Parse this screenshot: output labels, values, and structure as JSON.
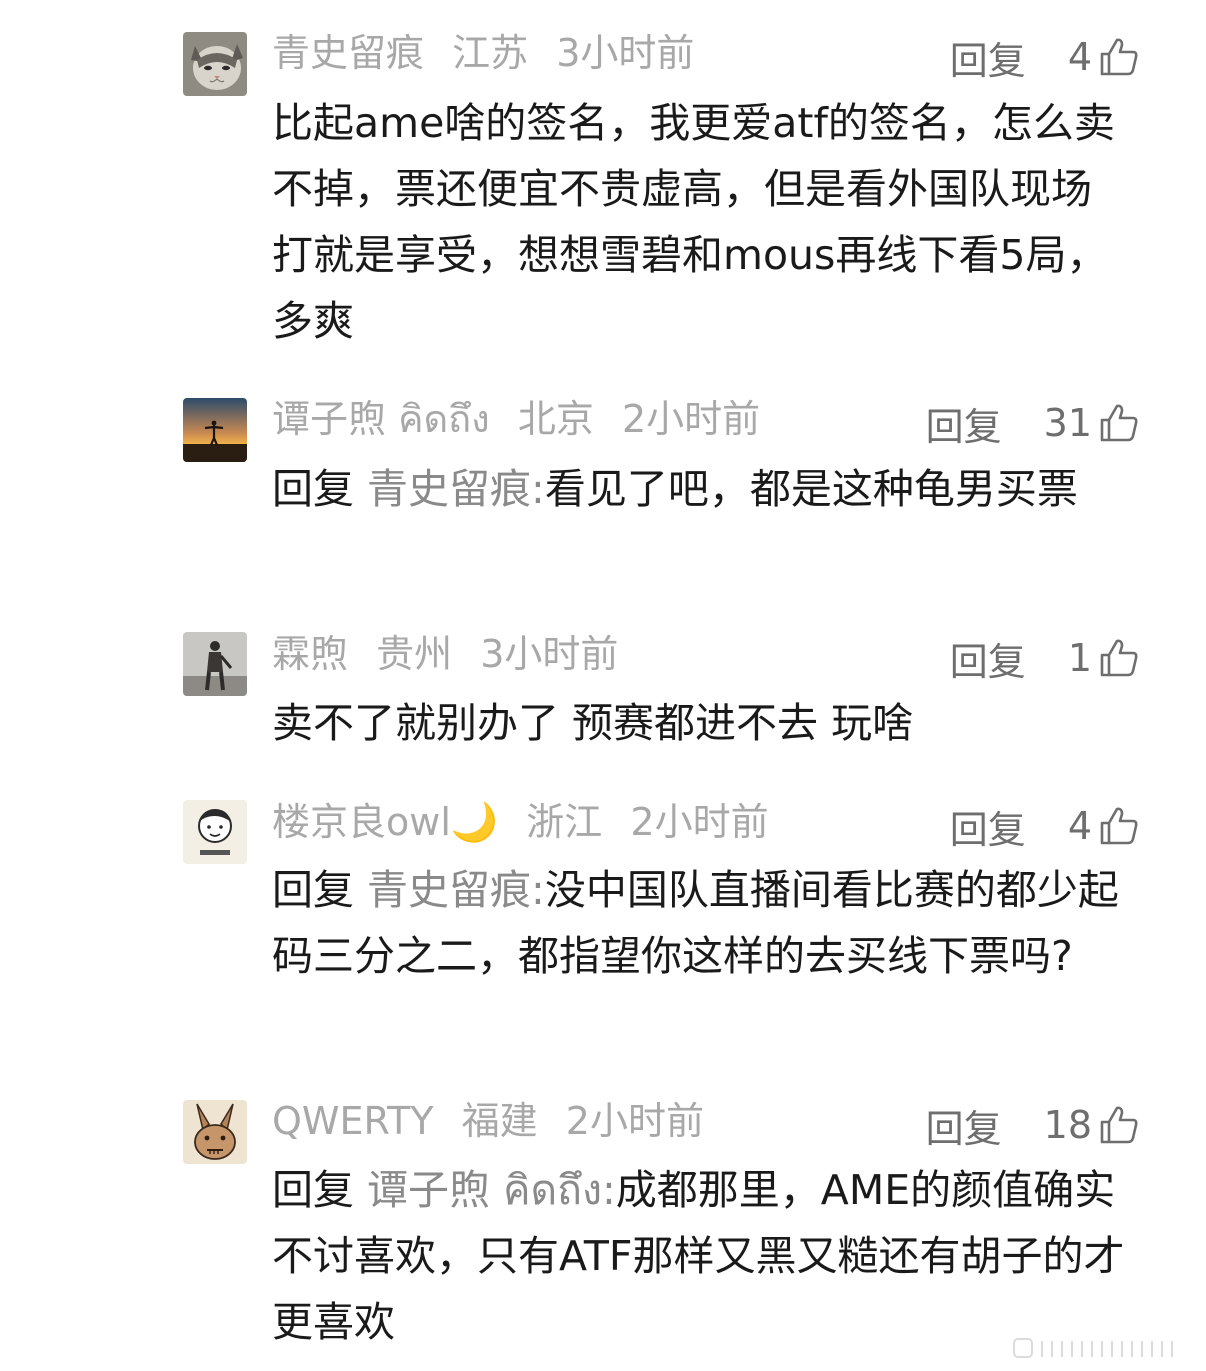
{
  "comments": [
    {
      "username": "青史留痕",
      "location": "江苏",
      "time": "3小时前",
      "reply_label": "回复",
      "likes": "4",
      "avatar_icon": "cat-avatar",
      "text": "比起ame啥的签名，我更爱atf的签名，怎么卖不掉，票还便宜不贵虚高，但是看外国队现场打就是享受，想想雪碧和mous再线下看5局，多爽"
    },
    {
      "username": "谭子煦 คิดถึง",
      "location": "北京",
      "time": "2小时前",
      "reply_label": "回复",
      "likes": "31",
      "avatar_icon": "sunset-avatar",
      "reply_prefix": "回复",
      "reply_target": "青史留痕:",
      "text": "看见了吧，都是这种龟男买票"
    },
    {
      "username": "霖煦",
      "location": "贵州",
      "time": "3小时前",
      "reply_label": "回复",
      "likes": "1",
      "avatar_icon": "figure-avatar",
      "text": "卖不了就别办了 预赛都进不去 玩啥"
    },
    {
      "username": "楼京良owl🌙",
      "location": "浙江",
      "time": "2小时前",
      "reply_label": "回复",
      "likes": "4",
      "avatar_icon": "cartoon-face-avatar",
      "reply_prefix": "回复",
      "reply_target": "青史留痕:",
      "text": "没中国队直播间看比赛的都少起码三分之二，都指望你这样的去买线下票吗?"
    },
    {
      "username": "QWERTY",
      "location": "福建",
      "time": "2小时前",
      "reply_label": "回复",
      "likes": "18",
      "avatar_icon": "rabbit-avatar",
      "reply_prefix": "回复",
      "reply_target": "谭子煦 คิดถึง:",
      "text": "成都那里，AME的颜值确实不讨喜欢，只有ATF那样又黑又糙还有胡子的才更喜欢"
    }
  ],
  "colors": {
    "meta": "#a8a8a8",
    "text": "#1a1a1a",
    "reply_target": "#8a8a8a",
    "action": "#6e6e6e"
  }
}
